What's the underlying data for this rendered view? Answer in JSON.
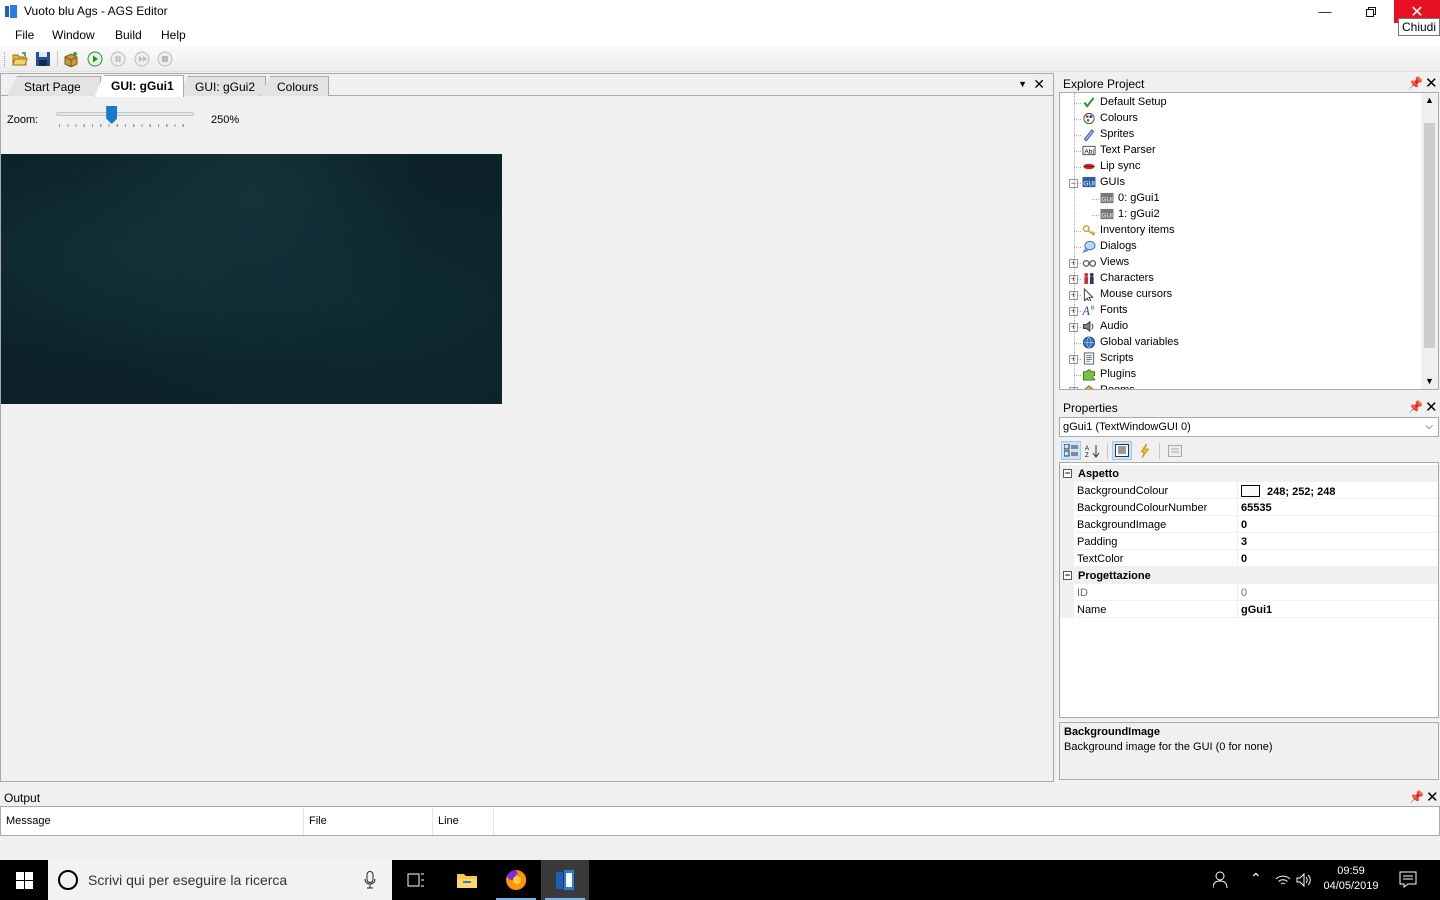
{
  "window": {
    "title": "Vuoto blu Ags - AGS Editor",
    "close_tooltip": "Chiudi"
  },
  "menu": [
    "File",
    "Window",
    "Build",
    "Help"
  ],
  "toolbar": {
    "icons": [
      "open-icon",
      "save-icon",
      "build-icon",
      "run-icon",
      "pause-icon",
      "step-icon",
      "stop-icon"
    ]
  },
  "tabs": [
    "Start Page",
    "GUI: gGui1",
    "GUI: gGui2",
    "Colours"
  ],
  "active_tab": "GUI: gGui1",
  "zoom": {
    "label": "Zoom:",
    "value": "250%",
    "slider_fraction": 0.4
  },
  "explore": {
    "title": "Explore Project",
    "items": [
      {
        "label": "Default Setup",
        "icon": "check-icon",
        "expander": "",
        "indent": 0
      },
      {
        "label": "Colours",
        "icon": "palette-icon",
        "expander": "",
        "indent": 0
      },
      {
        "label": "Sprites",
        "icon": "sprites-icon",
        "expander": "",
        "indent": 0
      },
      {
        "label": "Text Parser",
        "icon": "text-parser-icon",
        "expander": "",
        "indent": 0
      },
      {
        "label": "Lip sync",
        "icon": "lips-icon",
        "expander": "",
        "indent": 0
      },
      {
        "label": "GUIs",
        "icon": "gui-icon",
        "expander": "−",
        "indent": 0
      },
      {
        "label": "0: gGui1",
        "icon": "gui-item-icon",
        "expander": "",
        "indent": 1
      },
      {
        "label": "1: gGui2",
        "icon": "gui-item-icon",
        "expander": "",
        "indent": 1
      },
      {
        "label": "Inventory items",
        "icon": "key-icon",
        "expander": "",
        "indent": 0
      },
      {
        "label": "Dialogs",
        "icon": "speech-bubble-icon",
        "expander": "",
        "indent": 0
      },
      {
        "label": "Views",
        "icon": "glasses-icon",
        "expander": "+",
        "indent": 0
      },
      {
        "label": "Characters",
        "icon": "characters-icon",
        "expander": "+",
        "indent": 0
      },
      {
        "label": "Mouse cursors",
        "icon": "cursor-icon",
        "expander": "+",
        "indent": 0
      },
      {
        "label": "Fonts",
        "icon": "font-icon",
        "expander": "+",
        "indent": 0
      },
      {
        "label": "Audio",
        "icon": "speaker-icon",
        "expander": "+",
        "indent": 0
      },
      {
        "label": "Global variables",
        "icon": "globe-icon",
        "expander": "",
        "indent": 0
      },
      {
        "label": "Scripts",
        "icon": "scripts-icon",
        "expander": "+",
        "indent": 0
      },
      {
        "label": "Plugins",
        "icon": "puzzle-icon",
        "expander": "",
        "indent": 0
      },
      {
        "label": "Rooms",
        "icon": "rooms-icon",
        "expander": "+",
        "indent": 0
      }
    ]
  },
  "properties": {
    "title": "Properties",
    "selected_object": "gGui1 (TextWindowGUI 0)",
    "categories": [
      {
        "name": "Aspetto",
        "rows": [
          {
            "name": "BackgroundColour",
            "value": "248; 252; 248",
            "swatch": "#f8fcf8"
          },
          {
            "name": "BackgroundColourNumber",
            "value": "65535"
          },
          {
            "name": "BackgroundImage",
            "value": "0"
          },
          {
            "name": "Padding",
            "value": "3"
          },
          {
            "name": "TextColor",
            "value": "0"
          }
        ]
      },
      {
        "name": "Progettazione",
        "rows": [
          {
            "name": "ID",
            "value": "0",
            "readonly": true
          },
          {
            "name": "Name",
            "value": "gGui1"
          }
        ]
      }
    ],
    "description_title": "BackgroundImage",
    "description_text": "Background image for the GUI (0 for none)"
  },
  "output": {
    "title": "Output",
    "columns": [
      "Message",
      "File",
      "Line"
    ]
  },
  "taskbar": {
    "search_placeholder": "Scrivi qui per eseguire la ricerca",
    "time": "09:59",
    "date": "04/05/2019"
  },
  "colors": {
    "accent": "#1979ca",
    "close_red": "#e81123",
    "canvas": "#0c2228"
  }
}
